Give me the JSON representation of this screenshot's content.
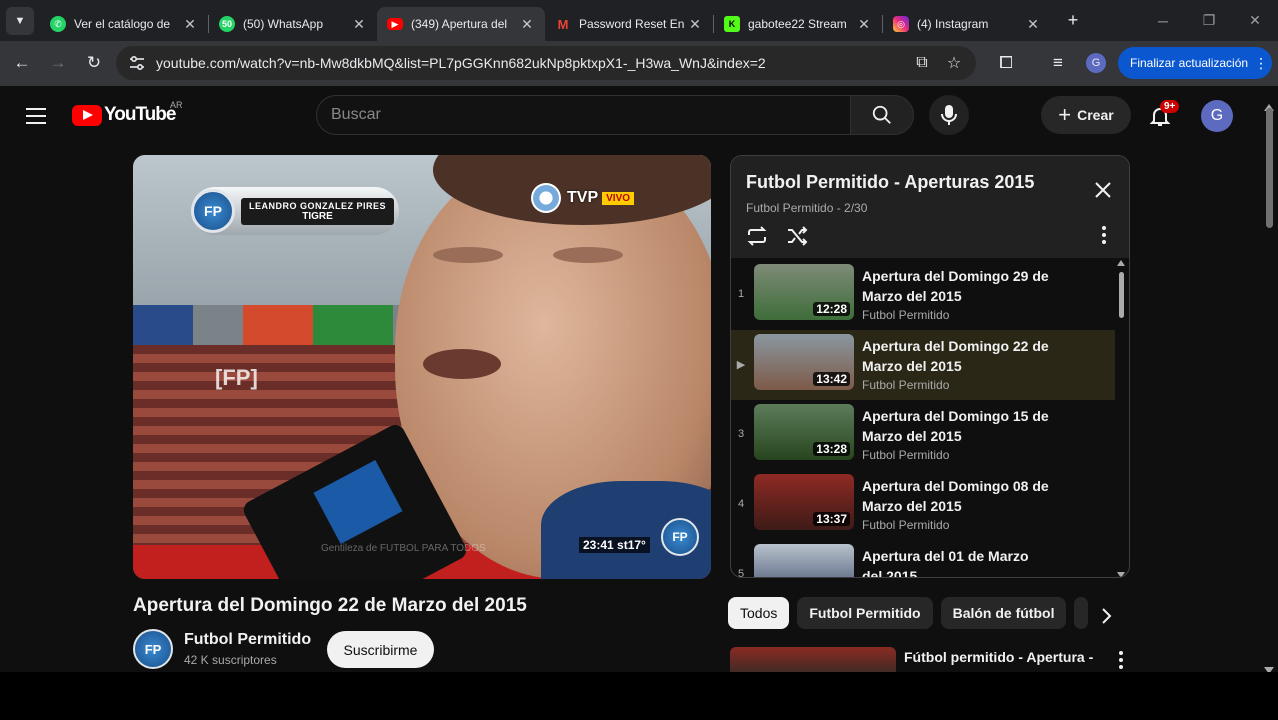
{
  "browser": {
    "tabs": [
      {
        "title": "Ver el catálogo de",
        "icon": "whatsapp-icon",
        "color": "#25d366"
      },
      {
        "title": "(50) WhatsApp",
        "icon": "whatsapp-business-icon",
        "color": "#25d366",
        "badge": "50"
      },
      {
        "title": "(349) Apertura del",
        "icon": "youtube-icon",
        "color": "#ff0000"
      },
      {
        "title": "Password Reset En",
        "icon": "gmail-icon",
        "color": "#ea4335"
      },
      {
        "title": "gabotee22 Stream",
        "icon": "kick-icon",
        "color": "#53fc18"
      },
      {
        "title": "(4) Instagram",
        "icon": "instagram-icon",
        "color": "#e1306c"
      }
    ],
    "active_tab": 2,
    "url": "youtube.com/watch?v=nb-Mw8dkbMQ&list=PL7pGGKnn682ukNp8pktxpX1-_H3wa_WnJ&index=2",
    "profile_initial": "G",
    "update_button": "Finalizar actualización"
  },
  "youtube": {
    "logo_text": "YouTube",
    "country_code": "AR",
    "search_placeholder": "Buscar",
    "create_label": "Crear",
    "notifications": "9+",
    "avatar_initial": "G",
    "video": {
      "title": "Apertura del Domingo 22 de Marzo del 2015",
      "overlay": {
        "player_name": "LEANDRO GONZALEZ PIRES",
        "club": "TIGRE",
        "network": "TVP",
        "live": "VIVO",
        "watermark": "[FP]",
        "clock": "23:41 st17°",
        "logo_text": "FP",
        "footer_text": "Gentileza de FUTBOL PARA TODOS"
      }
    },
    "channel": {
      "name": "Futbol Permitido",
      "avatar_text": "FP",
      "subscribers": "42 K suscriptores",
      "subscribe_label": "Suscribirme"
    },
    "playlist": {
      "title": "Futbol Permitido - Aperturas 2015",
      "meta": "Futbol Permitido - 2/30",
      "items": [
        {
          "index": "1",
          "title": "Apertura del Domingo 29 de Marzo del 2015",
          "channel": "Futbol Permitido",
          "duration": "12:28",
          "active": false
        },
        {
          "index": "▶",
          "title": "Apertura del Domingo 22 de Marzo del 2015",
          "channel": "Futbol Permitido",
          "duration": "13:42",
          "active": true
        },
        {
          "index": "3",
          "title": "Apertura del Domingo 15 de Marzo del 2015",
          "channel": "Futbol Permitido",
          "duration": "13:28",
          "active": false
        },
        {
          "index": "4",
          "title": "Apertura del Domingo 08 de Marzo del 2015",
          "channel": "Futbol Permitido",
          "duration": "13:37",
          "active": false
        },
        {
          "index": "5",
          "title": "Apertura del 01 de Marzo del 2015",
          "channel": "",
          "duration": "",
          "active": false
        }
      ]
    },
    "chips": [
      "Todos",
      "Futbol Permitido",
      "Balón de fútbol"
    ],
    "related": {
      "title": "Fútbol permitido - Apertura -"
    }
  }
}
